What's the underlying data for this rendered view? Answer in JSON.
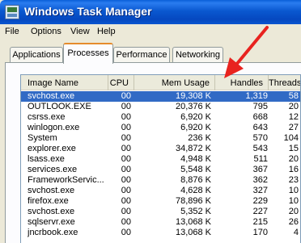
{
  "window": {
    "title": "Windows Task Manager"
  },
  "menu": [
    "File",
    "Options",
    "View",
    "Help"
  ],
  "tabs": [
    {
      "label": "Applications",
      "active": false
    },
    {
      "label": "Processes",
      "active": true
    },
    {
      "label": "Performance",
      "active": false
    },
    {
      "label": "Networking",
      "active": false
    }
  ],
  "columns": {
    "name": "Image Name",
    "cpu": "CPU",
    "mem": "Mem Usage",
    "handles": "Handles",
    "threads": "Threads"
  },
  "processes": [
    {
      "name": "svchost.exe",
      "cpu": "00",
      "mem": "19,308 K",
      "handles": "1,319",
      "threads": "58",
      "selected": true
    },
    {
      "name": "OUTLOOK.EXE",
      "cpu": "00",
      "mem": "20,376 K",
      "handles": "795",
      "threads": "20"
    },
    {
      "name": "csrss.exe",
      "cpu": "00",
      "mem": "6,920 K",
      "handles": "668",
      "threads": "12"
    },
    {
      "name": "winlogon.exe",
      "cpu": "00",
      "mem": "6,920 K",
      "handles": "643",
      "threads": "27"
    },
    {
      "name": "System",
      "cpu": "00",
      "mem": "236 K",
      "handles": "570",
      "threads": "104"
    },
    {
      "name": "explorer.exe",
      "cpu": "00",
      "mem": "34,872 K",
      "handles": "543",
      "threads": "15"
    },
    {
      "name": "lsass.exe",
      "cpu": "00",
      "mem": "4,948 K",
      "handles": "511",
      "threads": "20"
    },
    {
      "name": "services.exe",
      "cpu": "00",
      "mem": "5,548 K",
      "handles": "367",
      "threads": "16"
    },
    {
      "name": "FrameworkServic...",
      "cpu": "00",
      "mem": "8,876 K",
      "handles": "362",
      "threads": "23"
    },
    {
      "name": "svchost.exe",
      "cpu": "00",
      "mem": "4,628 K",
      "handles": "327",
      "threads": "10"
    },
    {
      "name": "firefox.exe",
      "cpu": "00",
      "mem": "78,896 K",
      "handles": "229",
      "threads": "10"
    },
    {
      "name": "svchost.exe",
      "cpu": "00",
      "mem": "5,352 K",
      "handles": "227",
      "threads": "20"
    },
    {
      "name": "sqlservr.exe",
      "cpu": "00",
      "mem": "13,068 K",
      "handles": "215",
      "threads": "26"
    },
    {
      "name": "jncrbook.exe",
      "cpu": "00",
      "mem": "13,068 K",
      "handles": "170",
      "threads": "4"
    }
  ],
  "colors": {
    "title_bar": "#0a58d0",
    "selection": "#316ac5",
    "active_tab_accent": "#e68b2c",
    "annotation_arrow": "#e8231f"
  },
  "annotation": {
    "icon": "red-arrow-icon",
    "points_to": "Handles column header"
  }
}
